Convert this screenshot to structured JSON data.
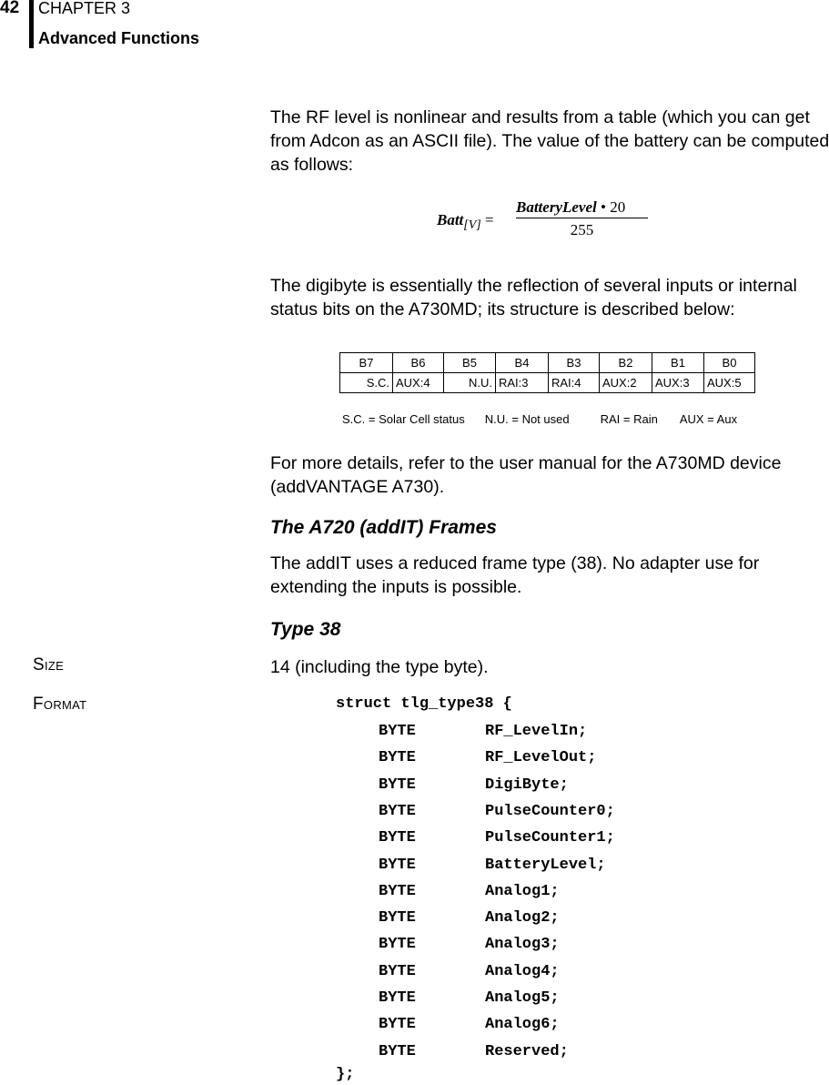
{
  "header": {
    "page_number": "42",
    "chapter": "CHAPTER 3",
    "section": "Advanced Functions"
  },
  "paragraphs": {
    "rf_level": "The RF level is nonlinear and results from a table (which you can get from Adcon as an ASCII file). The value of the battery can be computed as follows:",
    "digibyte": "The digibyte is essentially the reflection of several inputs or internal status bits on the A730MD; its structure is described below:",
    "more_details": "For more details, refer to the user manual for the A730MD device (addVANTAGE A730).",
    "addit": "The addIT uses a reduced frame type (38). No adapter use for extending the inputs is possible."
  },
  "formula": {
    "lhs": "Batt",
    "lhs_subscript": "[V]",
    "equals": "=",
    "numerator_var": "BatteryLevel",
    "numerator_op": " • 20",
    "denominator": "255"
  },
  "bit_table": {
    "headers": [
      "B7",
      "B6",
      "B5",
      "B4",
      "B3",
      "B2",
      "B1",
      "B0"
    ],
    "values": [
      "S.C.",
      "AUX:4",
      "N.U.",
      "RAI:3",
      "RAI:4",
      "AUX:2",
      "AUX:3",
      "AUX:5"
    ],
    "legend": [
      "S.C. = Solar Cell status",
      "N.U. = Not used",
      "RAI = Rain",
      "AUX = Aux"
    ]
  },
  "headings": {
    "a720": "The A720 (addIT) Frames",
    "type38": "Type 38"
  },
  "fields": {
    "size_label": "Size",
    "size_value": "14 (including the type byte).",
    "format_label": "Format"
  },
  "code": {
    "open": "struct tlg_type38 {",
    "members": [
      {
        "type": "BYTE",
        "name": "RF_LevelIn;"
      },
      {
        "type": "BYTE",
        "name": "RF_LevelOut;"
      },
      {
        "type": "BYTE",
        "name": "DigiByte;"
      },
      {
        "type": "BYTE",
        "name": "PulseCounter0;"
      },
      {
        "type": "BYTE",
        "name": "PulseCounter1;"
      },
      {
        "type": "BYTE",
        "name": "BatteryLevel;"
      },
      {
        "type": "BYTE",
        "name": "Analog1;"
      },
      {
        "type": "BYTE",
        "name": "Analog2;"
      },
      {
        "type": "BYTE",
        "name": "Analog3;"
      },
      {
        "type": "BYTE",
        "name": "Analog4;"
      },
      {
        "type": "BYTE",
        "name": "Analog5;"
      },
      {
        "type": "BYTE",
        "name": "Analog6;"
      },
      {
        "type": "BYTE",
        "name": "Reserved;"
      }
    ],
    "close": "};"
  }
}
